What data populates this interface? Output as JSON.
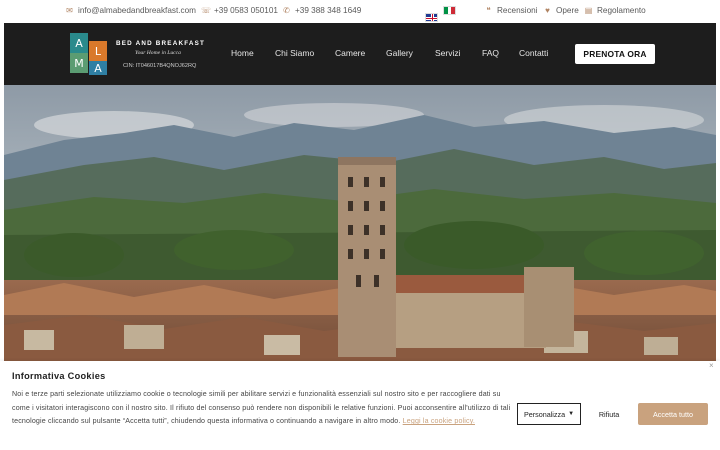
{
  "topbar": {
    "email": "info@almabedandbreakfast.com",
    "phone1": "+39 0583 050101",
    "phone2": "+39 388 348 1649",
    "links": [
      "Recensioni",
      "Opere",
      "Regolamento"
    ]
  },
  "brand": {
    "letters": [
      "A",
      "L",
      "M",
      "A"
    ],
    "title": "BED AND BREAKFAST",
    "subtitle": "Your Home in Lucca",
    "cin": "CIN: IT046017B4QNOJ62RQ",
    "colors": [
      "#2a8a8c",
      "#d9792b",
      "#5b9c72",
      "#2f7fa3"
    ]
  },
  "nav": {
    "items": [
      "Home",
      "Chi Siamo",
      "Camere",
      "Gallery",
      "Servizi",
      "FAQ",
      "Contatti"
    ],
    "cta": "PRENOTA ORA"
  },
  "cookie": {
    "close": "×",
    "title": "Informativa Cookies",
    "text": "Noi e terze parti selezionate utilizziamo cookie o tecnologie simili per abilitare servizi e funzionalità essenziali sul nostro sito e per raccogliere dati su come i visitatori interagiscono con il nostro sito. Il rifiuto del consenso può rendere non disponibili le relative funzioni. Puoi acconsentire all'utilizzo di tali tecnologie cliccando sul pulsante “Accetta tutti”, chiudendo questa informativa o continuando a navigare in altro modo.",
    "link": "Leggi la cookie policy.",
    "btn_custom": "Personalizza",
    "btn_reject": "Rifiuta",
    "btn_accept": "Accetta tutto",
    "accent": "#c9a27e"
  }
}
